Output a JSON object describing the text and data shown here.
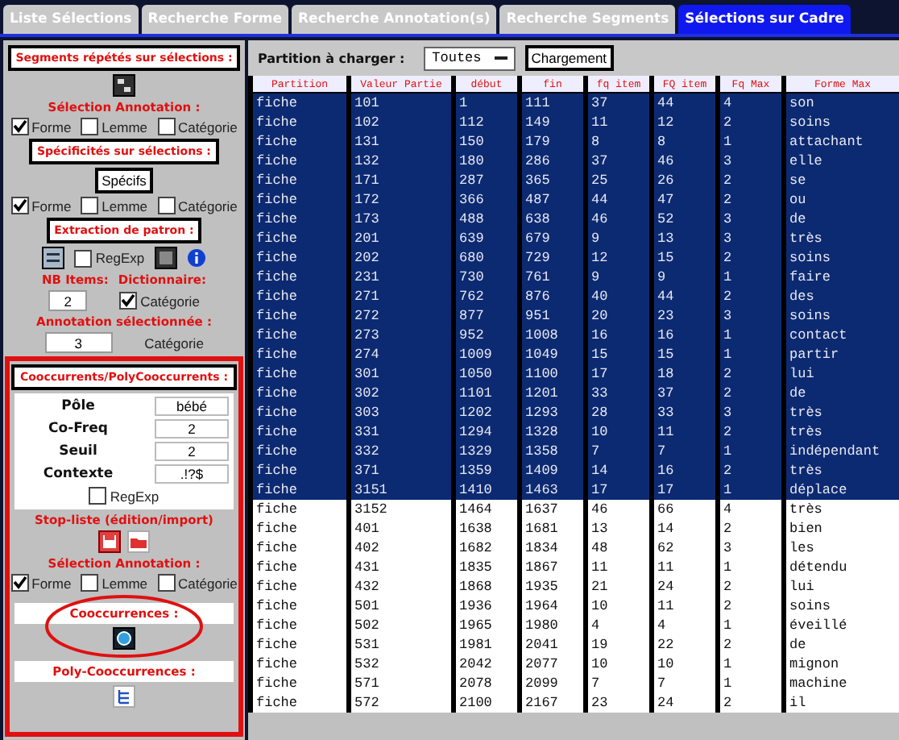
{
  "tabs": [
    {
      "label": "Liste Sélections",
      "selected": false
    },
    {
      "label": "Recherche Forme",
      "selected": false
    },
    {
      "label": "Recherche Annotation(s)",
      "selected": false
    },
    {
      "label": "Recherche Segments",
      "selected": false
    },
    {
      "label": "Sélections sur Cadre",
      "selected": true
    }
  ],
  "sidebar": {
    "segments_title": "Segments répétés sur sélections :",
    "segments_annotation": {
      "title": "Sélection Annotation :",
      "options": [
        {
          "label": "Forme",
          "checked": true
        },
        {
          "label": "Lemme",
          "checked": false
        },
        {
          "label": "Catégorie",
          "checked": false
        }
      ]
    },
    "specificites_title": "Spécificités sur sélections :",
    "specifs_button": "Spécifs",
    "specificites_options": [
      {
        "label": "Forme",
        "checked": true
      },
      {
        "label": "Lemme",
        "checked": false
      },
      {
        "label": "Catégorie",
        "checked": false
      }
    ],
    "patron_title": "Extraction de patron :",
    "patron_regexp": {
      "label": "RegExp",
      "checked": false
    },
    "nb_items": {
      "label": "NB Items:",
      "value": "2"
    },
    "dictionnaire": {
      "label": "Dictionnaire:",
      "option": {
        "label": "Catégorie",
        "checked": true
      }
    },
    "annotation_selectionnee": {
      "label": "Annotation sélectionnée :",
      "value": "3",
      "option": "Catégorie"
    },
    "cooc": {
      "title": "Cooccurrents/PolyCooccurrents :",
      "fields": [
        {
          "label": "Pôle",
          "value": "bébé"
        },
        {
          "label": "Co-Freq",
          "value": "2"
        },
        {
          "label": "Seuil",
          "value": "2"
        },
        {
          "label": "Contexte",
          "value": ".!?$"
        }
      ],
      "regexp": {
        "label": "RegExp",
        "checked": false
      },
      "stoplist_title": "Stop-liste (édition/import)",
      "annotation": {
        "title": "Sélection Annotation :",
        "options": [
          {
            "label": "Forme",
            "checked": true
          },
          {
            "label": "Lemme",
            "checked": false
          },
          {
            "label": "Catégorie",
            "checked": false
          }
        ]
      },
      "cooccurrences_title": "Cooccurrences :",
      "poly_title": "Poly-Cooccurrences :"
    }
  },
  "toolbar": {
    "label": "Partition à charger :",
    "select": "Toutes",
    "button": "Chargement"
  },
  "table": {
    "columns": [
      "Partition",
      "Valeur Partie",
      "début",
      "fin",
      "fq item",
      "FQ item",
      "Fq Max",
      "Forme Max"
    ],
    "rows": [
      {
        "selected": true,
        "cells": [
          "fiche",
          "101",
          "1",
          "111",
          "37",
          "44",
          "4",
          "son"
        ]
      },
      {
        "selected": true,
        "cells": [
          "fiche",
          "102",
          "112",
          "149",
          "11",
          "12",
          "2",
          "soins"
        ]
      },
      {
        "selected": true,
        "cells": [
          "fiche",
          "131",
          "150",
          "179",
          "8",
          "8",
          "1",
          "attachant"
        ]
      },
      {
        "selected": true,
        "cells": [
          "fiche",
          "132",
          "180",
          "286",
          "37",
          "46",
          "3",
          "elle"
        ]
      },
      {
        "selected": true,
        "cells": [
          "fiche",
          "171",
          "287",
          "365",
          "25",
          "26",
          "2",
          "se"
        ]
      },
      {
        "selected": true,
        "cells": [
          "fiche",
          "172",
          "366",
          "487",
          "44",
          "47",
          "2",
          "ou"
        ]
      },
      {
        "selected": true,
        "cells": [
          "fiche",
          "173",
          "488",
          "638",
          "46",
          "52",
          "3",
          "de"
        ]
      },
      {
        "selected": true,
        "cells": [
          "fiche",
          "201",
          "639",
          "679",
          "9",
          "13",
          "3",
          "très"
        ]
      },
      {
        "selected": true,
        "cells": [
          "fiche",
          "202",
          "680",
          "729",
          "12",
          "15",
          "2",
          "soins"
        ]
      },
      {
        "selected": true,
        "cells": [
          "fiche",
          "231",
          "730",
          "761",
          "9",
          "9",
          "1",
          "faire"
        ]
      },
      {
        "selected": true,
        "cells": [
          "fiche",
          "271",
          "762",
          "876",
          "40",
          "44",
          "2",
          "des"
        ]
      },
      {
        "selected": true,
        "cells": [
          "fiche",
          "272",
          "877",
          "951",
          "20",
          "23",
          "3",
          "soins"
        ]
      },
      {
        "selected": true,
        "cells": [
          "fiche",
          "273",
          "952",
          "1008",
          "16",
          "16",
          "1",
          "contact"
        ]
      },
      {
        "selected": true,
        "cells": [
          "fiche",
          "274",
          "1009",
          "1049",
          "15",
          "15",
          "1",
          "partir"
        ]
      },
      {
        "selected": true,
        "cells": [
          "fiche",
          "301",
          "1050",
          "1100",
          "17",
          "18",
          "2",
          "lui"
        ]
      },
      {
        "selected": true,
        "cells": [
          "fiche",
          "302",
          "1101",
          "1201",
          "33",
          "37",
          "2",
          "de"
        ]
      },
      {
        "selected": true,
        "cells": [
          "fiche",
          "303",
          "1202",
          "1293",
          "28",
          "33",
          "3",
          "très"
        ]
      },
      {
        "selected": true,
        "cells": [
          "fiche",
          "331",
          "1294",
          "1328",
          "10",
          "11",
          "2",
          "très"
        ]
      },
      {
        "selected": true,
        "cells": [
          "fiche",
          "332",
          "1329",
          "1358",
          "7",
          "7",
          "1",
          "indépendant"
        ]
      },
      {
        "selected": true,
        "cells": [
          "fiche",
          "371",
          "1359",
          "1409",
          "14",
          "16",
          "2",
          "très"
        ]
      },
      {
        "selected": true,
        "cells": [
          "fiche",
          "3151",
          "1410",
          "1463",
          "17",
          "17",
          "1",
          "déplace"
        ]
      },
      {
        "selected": false,
        "cells": [
          "fiche",
          "3152",
          "1464",
          "1637",
          "46",
          "66",
          "4",
          "très"
        ]
      },
      {
        "selected": false,
        "cells": [
          "fiche",
          "401",
          "1638",
          "1681",
          "13",
          "14",
          "2",
          "bien"
        ]
      },
      {
        "selected": false,
        "cells": [
          "fiche",
          "402",
          "1682",
          "1834",
          "48",
          "62",
          "3",
          "les"
        ]
      },
      {
        "selected": false,
        "cells": [
          "fiche",
          "431",
          "1835",
          "1867",
          "11",
          "11",
          "1",
          "détendu"
        ]
      },
      {
        "selected": false,
        "cells": [
          "fiche",
          "432",
          "1868",
          "1935",
          "21",
          "24",
          "2",
          "lui"
        ]
      },
      {
        "selected": false,
        "cells": [
          "fiche",
          "501",
          "1936",
          "1964",
          "10",
          "11",
          "2",
          "soins"
        ]
      },
      {
        "selected": false,
        "cells": [
          "fiche",
          "502",
          "1965",
          "1980",
          "4",
          "4",
          "1",
          "éveillé"
        ]
      },
      {
        "selected": false,
        "cells": [
          "fiche",
          "531",
          "1981",
          "2041",
          "19",
          "22",
          "2",
          "de"
        ]
      },
      {
        "selected": false,
        "cells": [
          "fiche",
          "532",
          "2042",
          "2077",
          "10",
          "10",
          "1",
          "mignon"
        ]
      },
      {
        "selected": false,
        "cells": [
          "fiche",
          "571",
          "2078",
          "2099",
          "7",
          "7",
          "1",
          "machine"
        ]
      },
      {
        "selected": false,
        "cells": [
          "fiche",
          "572",
          "2100",
          "2167",
          "23",
          "24",
          "2",
          "il"
        ]
      }
    ]
  }
}
